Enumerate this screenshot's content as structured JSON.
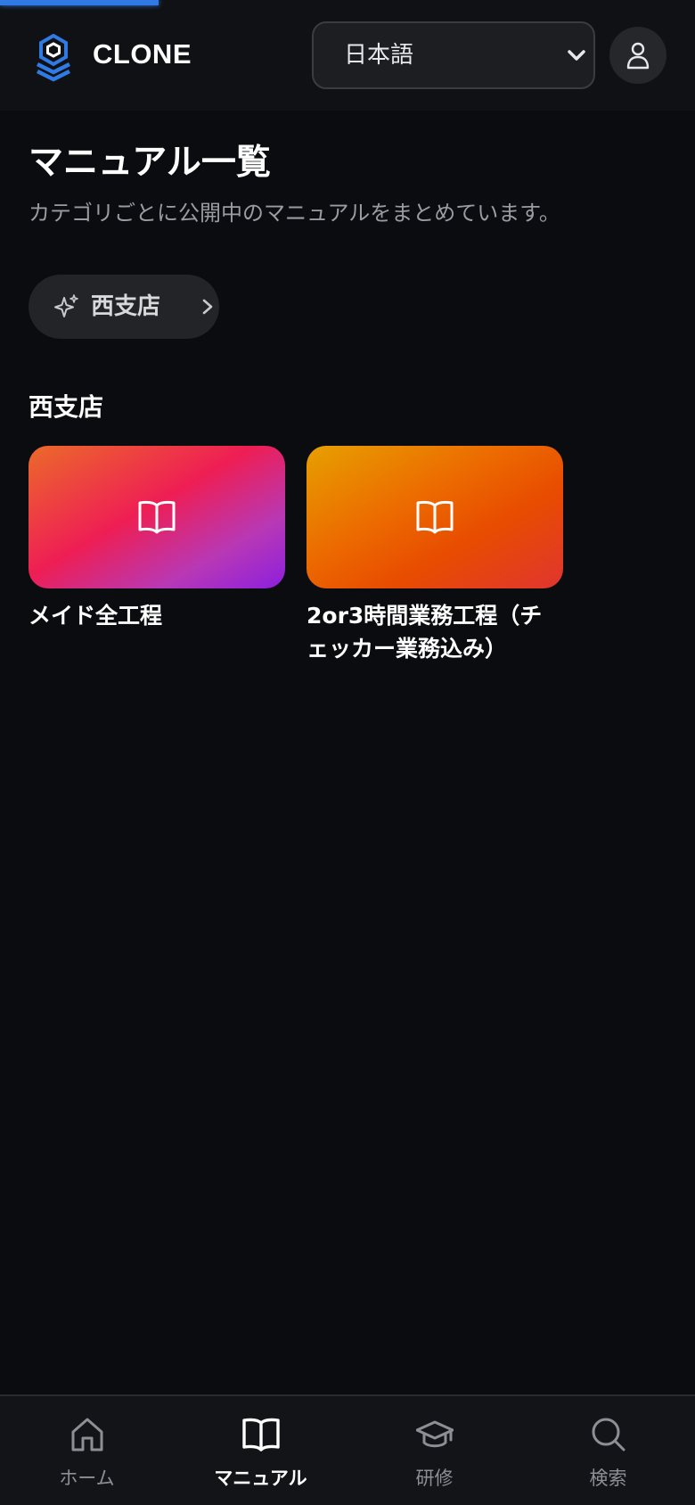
{
  "header": {
    "brand": "CLONE",
    "language": {
      "selected": "日本語"
    }
  },
  "main": {
    "title": "マニュアル一覧",
    "subtitle": "カテゴリごとに公開中のマニュアルをまとめています。",
    "category_chip": {
      "label": "西支店"
    },
    "sections": [
      {
        "title": "西支店",
        "cards": [
          {
            "title": "メイド全工程"
          },
          {
            "title": "2or3時間業務工程（チェッカー業務込み）"
          }
        ]
      }
    ]
  },
  "bottom_nav": {
    "items": [
      {
        "label": "ホーム",
        "icon": "home-icon",
        "active": false
      },
      {
        "label": "マニュアル",
        "icon": "book-icon",
        "active": true
      },
      {
        "label": "研修",
        "icon": "graduation-cap-icon",
        "active": false
      },
      {
        "label": "検索",
        "icon": "search-icon",
        "active": false
      }
    ]
  },
  "colors": {
    "background": "#0b0c10",
    "header": "#101114",
    "accent": "#2f7ae5",
    "card_1_gradient": [
      "#ec6a2a",
      "#ee1e54",
      "#8d1fde"
    ],
    "card_2_gradient": [
      "#e7a000",
      "#ec6a00",
      "#e03530"
    ]
  }
}
